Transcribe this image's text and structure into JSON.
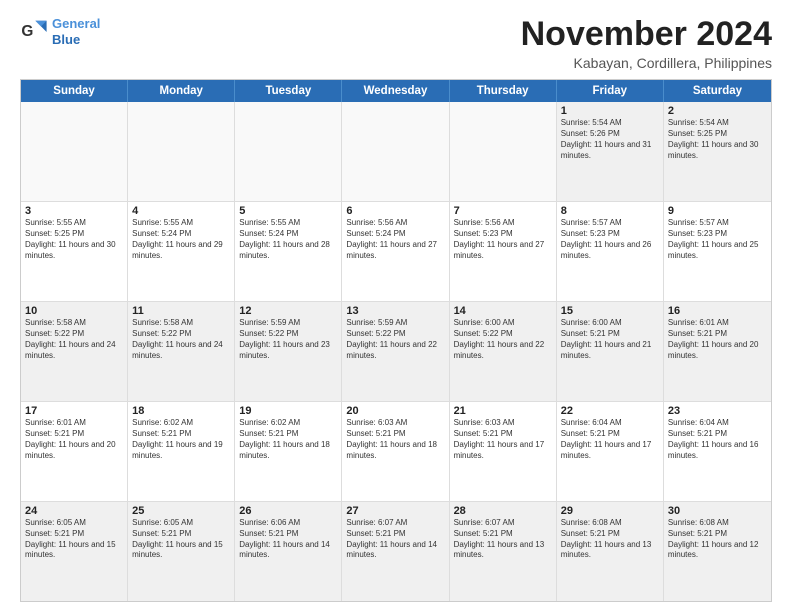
{
  "header": {
    "logo_line1": "General",
    "logo_line2": "Blue",
    "month": "November 2024",
    "location": "Kabayan, Cordillera, Philippines"
  },
  "days": [
    "Sunday",
    "Monday",
    "Tuesday",
    "Wednesday",
    "Thursday",
    "Friday",
    "Saturday"
  ],
  "rows": [
    [
      {
        "day": "",
        "empty": true
      },
      {
        "day": "",
        "empty": true
      },
      {
        "day": "",
        "empty": true
      },
      {
        "day": "",
        "empty": true
      },
      {
        "day": "",
        "empty": true
      },
      {
        "day": "1",
        "rise": "5:54 AM",
        "set": "5:26 PM",
        "daylight": "11 hours and 31 minutes."
      },
      {
        "day": "2",
        "rise": "5:54 AM",
        "set": "5:25 PM",
        "daylight": "11 hours and 30 minutes."
      }
    ],
    [
      {
        "day": "3",
        "rise": "5:55 AM",
        "set": "5:25 PM",
        "daylight": "11 hours and 30 minutes."
      },
      {
        "day": "4",
        "rise": "5:55 AM",
        "set": "5:24 PM",
        "daylight": "11 hours and 29 minutes."
      },
      {
        "day": "5",
        "rise": "5:55 AM",
        "set": "5:24 PM",
        "daylight": "11 hours and 28 minutes."
      },
      {
        "day": "6",
        "rise": "5:56 AM",
        "set": "5:24 PM",
        "daylight": "11 hours and 27 minutes."
      },
      {
        "day": "7",
        "rise": "5:56 AM",
        "set": "5:23 PM",
        "daylight": "11 hours and 27 minutes."
      },
      {
        "day": "8",
        "rise": "5:57 AM",
        "set": "5:23 PM",
        "daylight": "11 hours and 26 minutes."
      },
      {
        "day": "9",
        "rise": "5:57 AM",
        "set": "5:23 PM",
        "daylight": "11 hours and 25 minutes."
      }
    ],
    [
      {
        "day": "10",
        "rise": "5:58 AM",
        "set": "5:22 PM",
        "daylight": "11 hours and 24 minutes."
      },
      {
        "day": "11",
        "rise": "5:58 AM",
        "set": "5:22 PM",
        "daylight": "11 hours and 24 minutes."
      },
      {
        "day": "12",
        "rise": "5:59 AM",
        "set": "5:22 PM",
        "daylight": "11 hours and 23 minutes."
      },
      {
        "day": "13",
        "rise": "5:59 AM",
        "set": "5:22 PM",
        "daylight": "11 hours and 22 minutes."
      },
      {
        "day": "14",
        "rise": "6:00 AM",
        "set": "5:22 PM",
        "daylight": "11 hours and 22 minutes."
      },
      {
        "day": "15",
        "rise": "6:00 AM",
        "set": "5:21 PM",
        "daylight": "11 hours and 21 minutes."
      },
      {
        "day": "16",
        "rise": "6:01 AM",
        "set": "5:21 PM",
        "daylight": "11 hours and 20 minutes."
      }
    ],
    [
      {
        "day": "17",
        "rise": "6:01 AM",
        "set": "5:21 PM",
        "daylight": "11 hours and 20 minutes."
      },
      {
        "day": "18",
        "rise": "6:02 AM",
        "set": "5:21 PM",
        "daylight": "11 hours and 19 minutes."
      },
      {
        "day": "19",
        "rise": "6:02 AM",
        "set": "5:21 PM",
        "daylight": "11 hours and 18 minutes."
      },
      {
        "day": "20",
        "rise": "6:03 AM",
        "set": "5:21 PM",
        "daylight": "11 hours and 18 minutes."
      },
      {
        "day": "21",
        "rise": "6:03 AM",
        "set": "5:21 PM",
        "daylight": "11 hours and 17 minutes."
      },
      {
        "day": "22",
        "rise": "6:04 AM",
        "set": "5:21 PM",
        "daylight": "11 hours and 17 minutes."
      },
      {
        "day": "23",
        "rise": "6:04 AM",
        "set": "5:21 PM",
        "daylight": "11 hours and 16 minutes."
      }
    ],
    [
      {
        "day": "24",
        "rise": "6:05 AM",
        "set": "5:21 PM",
        "daylight": "11 hours and 15 minutes."
      },
      {
        "day": "25",
        "rise": "6:05 AM",
        "set": "5:21 PM",
        "daylight": "11 hours and 15 minutes."
      },
      {
        "day": "26",
        "rise": "6:06 AM",
        "set": "5:21 PM",
        "daylight": "11 hours and 14 minutes."
      },
      {
        "day": "27",
        "rise": "6:07 AM",
        "set": "5:21 PM",
        "daylight": "11 hours and 14 minutes."
      },
      {
        "day": "28",
        "rise": "6:07 AM",
        "set": "5:21 PM",
        "daylight": "11 hours and 13 minutes."
      },
      {
        "day": "29",
        "rise": "6:08 AM",
        "set": "5:21 PM",
        "daylight": "11 hours and 13 minutes."
      },
      {
        "day": "30",
        "rise": "6:08 AM",
        "set": "5:21 PM",
        "daylight": "11 hours and 12 minutes."
      }
    ]
  ]
}
